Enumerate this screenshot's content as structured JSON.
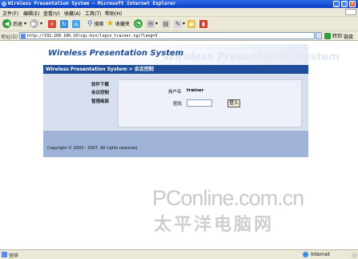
{
  "window": {
    "title": "Wireless Presentation System - Microsoft Internet Explorer"
  },
  "menu": [
    "文件(F)",
    "编辑(E)",
    "查看(V)",
    "收藏(A)",
    "工具(T)",
    "帮助(H)"
  ],
  "toolbar": {
    "back": "后退",
    "search": "搜索",
    "favorites": "收藏夹"
  },
  "address": {
    "label": "地址(D)",
    "url": "http://192.168.100.10/cgi-bin/login_trainer.cgi?lang=3",
    "go": "转到",
    "links": "链接"
  },
  "page": {
    "banner_title": "Wireless Presentation System",
    "nav_title": "Wireless Presentation System > 会议控制",
    "sidebar": [
      "软件下载",
      "会议控制",
      "管理画面"
    ],
    "form": {
      "username_label": "用户名",
      "username_value": "trainer",
      "password_label": "密码",
      "password_value": "",
      "login_button": "登入"
    },
    "footer": "Copyright © 2003 - 2007. All rights reserved."
  },
  "watermark": {
    "line1": "PConline.com.cn",
    "line2": "太平洋电脑网"
  },
  "status": {
    "text": "完毕",
    "zone": "Internet"
  }
}
